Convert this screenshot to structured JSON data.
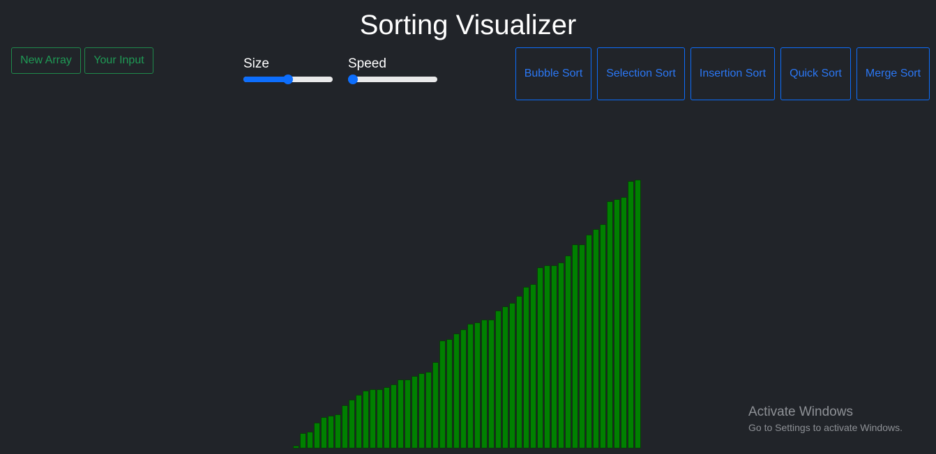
{
  "app": {
    "title": "Sorting Visualizer"
  },
  "controls": {
    "new_array_label": "New Array",
    "your_input_label": "Your Input"
  },
  "sliders": {
    "size": {
      "label": "Size",
      "value_fraction": 0.5
    },
    "speed": {
      "label": "Speed",
      "value_fraction": 0.0
    }
  },
  "algorithms": [
    {
      "label": "Bubble Sort"
    },
    {
      "label": "Selection Sort"
    },
    {
      "label": "Insertion Sort"
    },
    {
      "label": "Quick Sort"
    },
    {
      "label": "Merge Sort"
    }
  ],
  "colors": {
    "background": "#212429",
    "bar": "#008000",
    "primary": "#0d6efd",
    "success": "#1f9a55"
  },
  "array": {
    "state": "sorted",
    "values": [
      4,
      22,
      24,
      37,
      45,
      47,
      49,
      62,
      70,
      77,
      83,
      85,
      85,
      88,
      92,
      99,
      99,
      104,
      108,
      110,
      124,
      155,
      157,
      165,
      171,
      179,
      181,
      185,
      185,
      198,
      204,
      209,
      219,
      232,
      236,
      260,
      263,
      263,
      267,
      277,
      293,
      293,
      307,
      315,
      322,
      355,
      358,
      361,
      384,
      386
    ]
  },
  "watermark": {
    "title": "Activate Windows",
    "subtitle": "Go to Settings to activate Windows."
  }
}
